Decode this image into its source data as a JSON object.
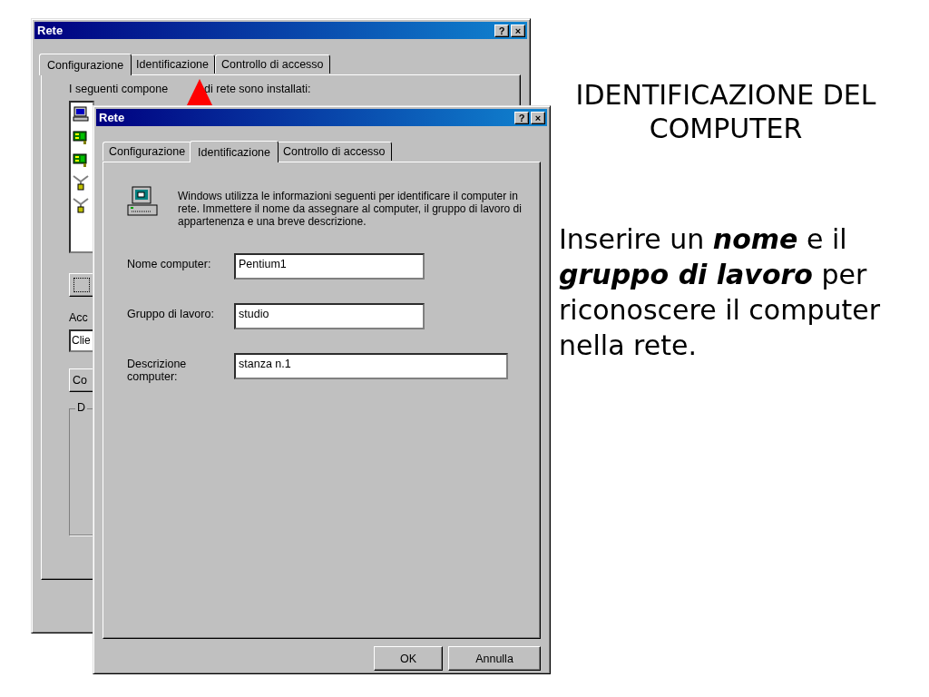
{
  "back_window": {
    "title": "Rete",
    "title_buttons": [
      "?",
      "×"
    ],
    "tabs": [
      {
        "label": "Configurazione",
        "selected": true
      },
      {
        "label": "Identificazione",
        "selected": false
      },
      {
        "label": "Controllo di accesso",
        "selected": false
      }
    ],
    "list_label_parts": [
      "I seguenti compone",
      "di rete sono installati:"
    ],
    "components": [
      {
        "kind": "computer"
      },
      {
        "kind": "adapter"
      },
      {
        "kind": "adapter"
      },
      {
        "kind": "protocol"
      },
      {
        "kind": "protocol"
      }
    ],
    "access_label": "Acc",
    "client_field": "Clie",
    "properties_button": "Co",
    "group_box": "D"
  },
  "front_window": {
    "title": "Rete",
    "title_buttons": [
      "?",
      "×"
    ],
    "tabs": [
      {
        "label": "Configurazione",
        "selected": false
      },
      {
        "label": "Identificazione",
        "selected": true
      },
      {
        "label": "Controllo di accesso",
        "selected": false
      }
    ],
    "intro": "Windows utilizza le informazioni seguenti per identificare il computer in rete. Immettere il nome da assegnare al computer, il gruppo di lavoro di appartenenza e una breve descrizione.",
    "fields": [
      {
        "label": "Nome computer:",
        "value": "Pentium1",
        "kind": "short"
      },
      {
        "label": "Gruppo di lavoro:",
        "value": "studio",
        "kind": "short"
      },
      {
        "label": "Descrizione computer:",
        "value": "stanza n.1",
        "kind": "long"
      }
    ],
    "buttons": [
      "OK",
      "Annulla"
    ]
  },
  "slide": {
    "heading": "IDENTIFICAZIONE DEL COMPUTER",
    "body": "Inserire un **nome**  e il **gruppo di lavoro** per riconoscere il computer nella rete."
  }
}
